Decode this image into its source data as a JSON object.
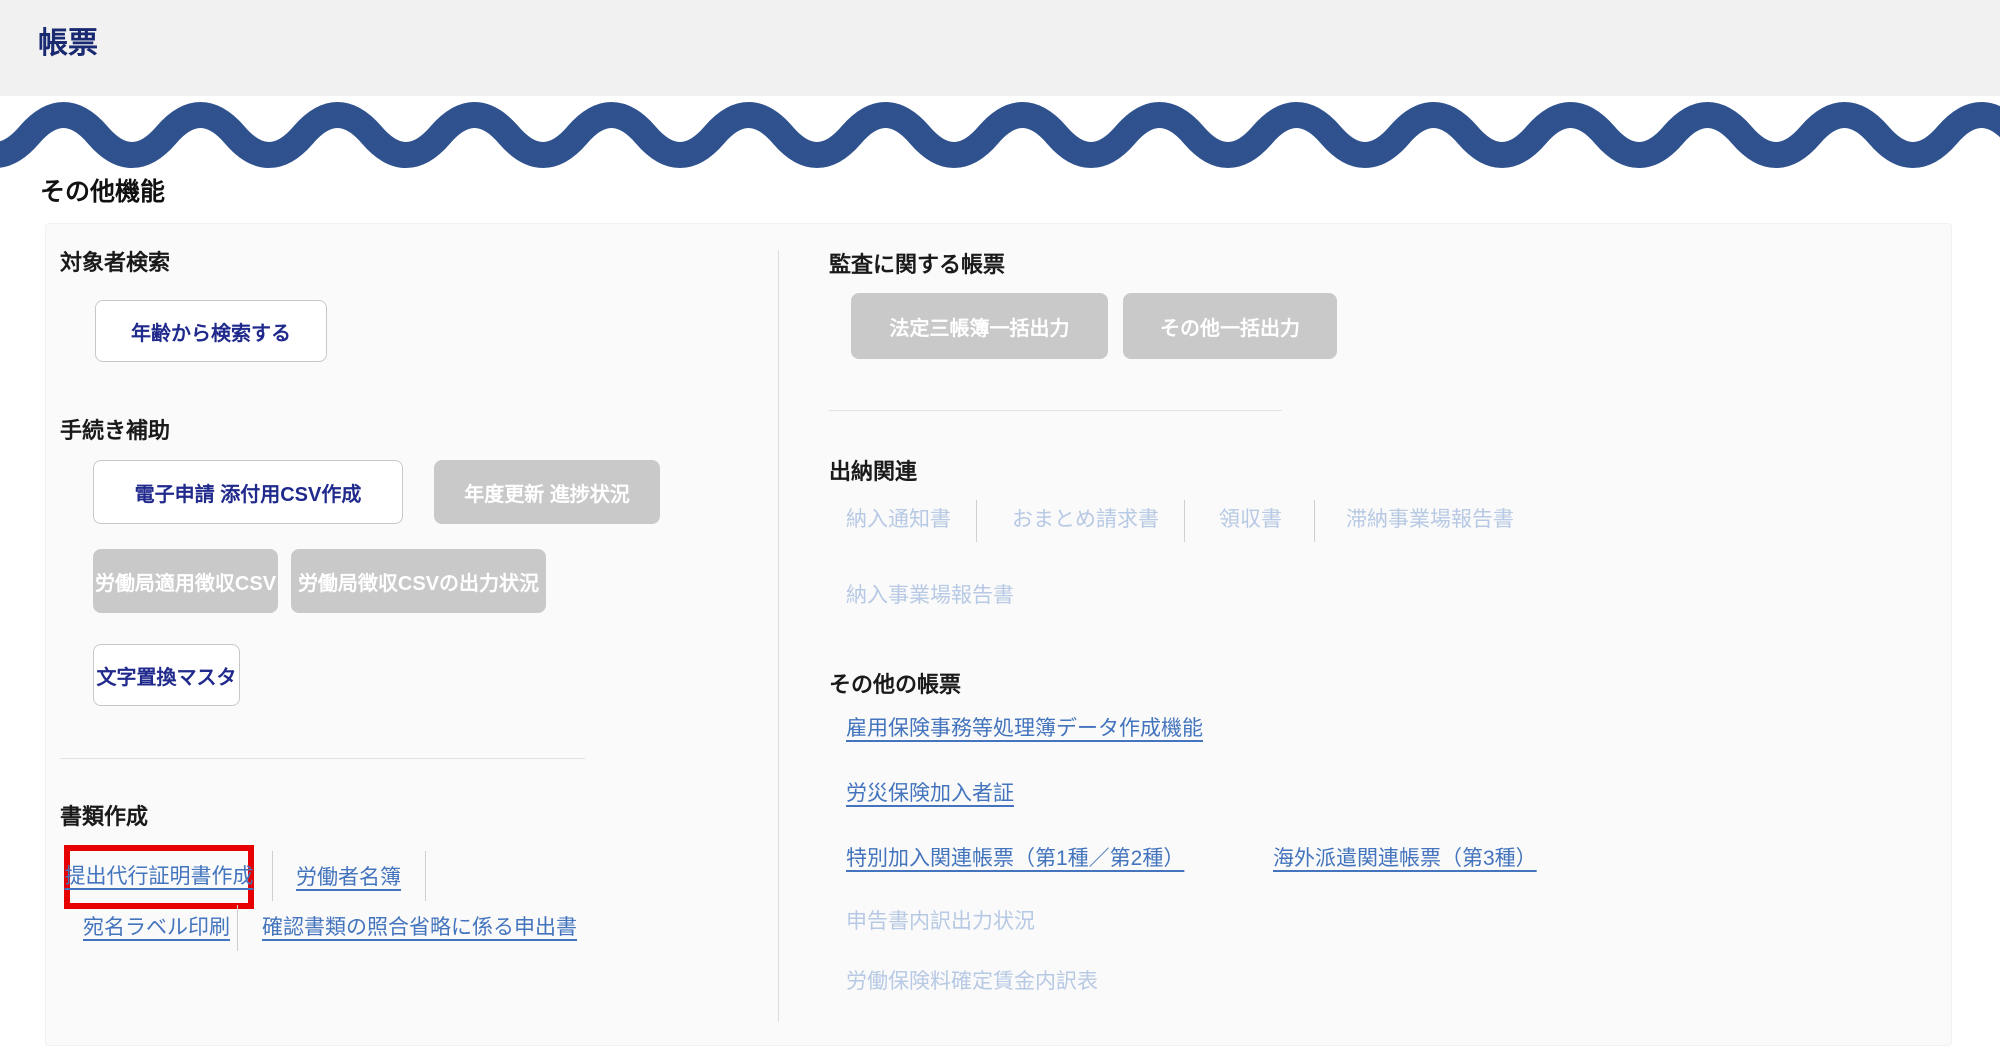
{
  "header": {
    "title": "帳票"
  },
  "page": {
    "section_title": "その他機能"
  },
  "colors": {
    "brand_wave_blue": "#2f528f",
    "header_bg": "#f1f1f1",
    "panel_bg": "#fafafa",
    "navy_button_text": "#20298c",
    "link_blue": "#4374bd",
    "link_disabled": "#b7c9e4",
    "disabled_button_bg": "#c9c9c9",
    "highlight_red": "#e60000"
  },
  "left": {
    "search": {
      "heading": "対象者検索",
      "button_label": "年齢から検索する"
    },
    "procedure": {
      "heading": "手続き補助",
      "buttons": [
        {
          "label": "電子申請 添付用CSV作成",
          "state": "enabled"
        },
        {
          "label": "年度更新 進捗状況",
          "state": "disabled"
        },
        {
          "label": "労働局適用徴収CSV",
          "state": "disabled"
        },
        {
          "label": "労働局徴収CSVの出力状況",
          "state": "disabled"
        },
        {
          "label": "文字置換マスタ",
          "state": "enabled"
        }
      ]
    },
    "documents": {
      "heading": "書類作成",
      "links": [
        {
          "label": "提出代行証明書作成",
          "state": "enabled",
          "highlighted": true
        },
        {
          "label": "労働者名簿",
          "state": "enabled",
          "highlighted": false
        },
        {
          "label": "宛名ラベル印刷",
          "state": "enabled",
          "highlighted": false
        },
        {
          "label": "確認書類の照合省略に係る申出書",
          "state": "enabled",
          "highlighted": false
        }
      ]
    }
  },
  "right": {
    "audit": {
      "heading": "監査に関する帳票",
      "buttons": [
        {
          "label": "法定三帳簿一括出力",
          "state": "disabled"
        },
        {
          "label": "その他一括出力",
          "state": "disabled"
        }
      ]
    },
    "cashier": {
      "heading": "出納関連",
      "links": [
        {
          "label": "納入通知書",
          "state": "disabled"
        },
        {
          "label": "おまとめ請求書",
          "state": "disabled"
        },
        {
          "label": "領収書",
          "state": "disabled"
        },
        {
          "label": "滞納事業場報告書",
          "state": "disabled"
        },
        {
          "label": "納入事業場報告書",
          "state": "disabled"
        }
      ]
    },
    "other": {
      "heading": "その他の帳票",
      "links": [
        {
          "label": "雇用保険事務等処理簿データ作成機能",
          "state": "enabled"
        },
        {
          "label": "労災保険加入者証",
          "state": "enabled"
        },
        {
          "label": "特別加入関連帳票（第1種／第2種）",
          "state": "enabled"
        },
        {
          "label": "海外派遣関連帳票（第3種）",
          "state": "enabled"
        },
        {
          "label": "申告書内訳出力状況",
          "state": "disabled"
        },
        {
          "label": "労働保険料確定賃金内訳表",
          "state": "disabled"
        }
      ]
    }
  }
}
